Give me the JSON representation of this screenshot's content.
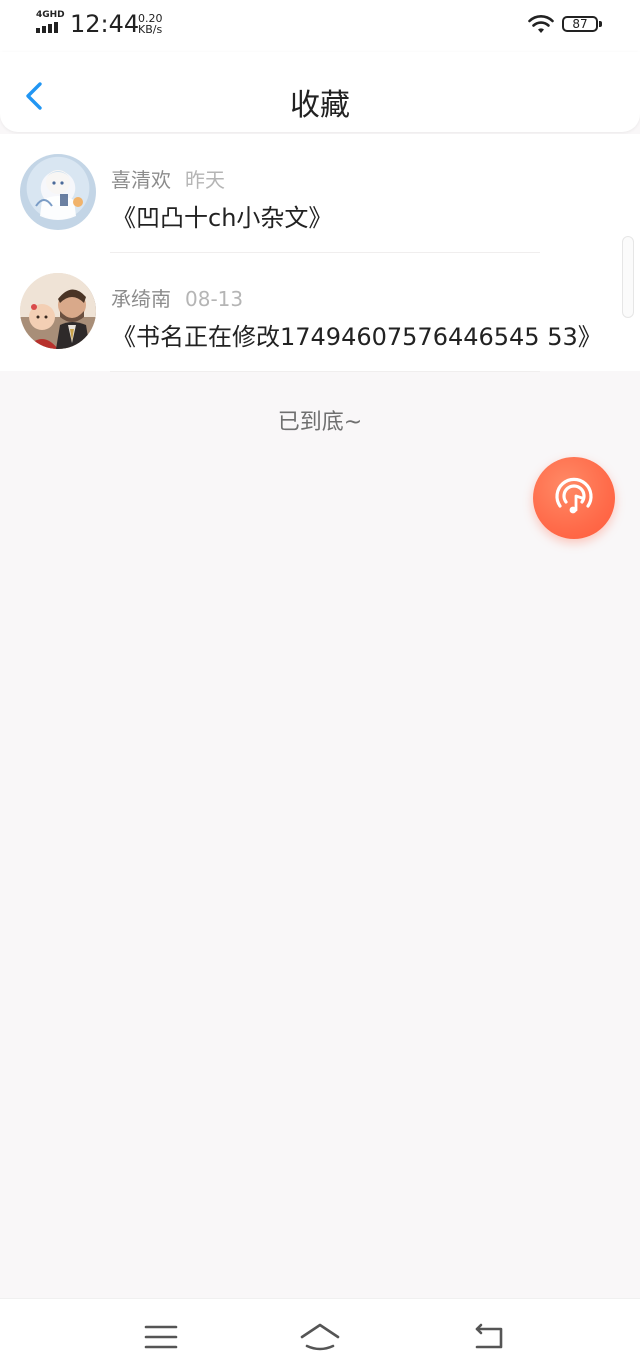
{
  "status_bar": {
    "network": "4GHD",
    "time": "12:44",
    "speed_value": "0.20",
    "speed_unit": "KB/s",
    "battery": "87"
  },
  "header": {
    "title": "收藏",
    "back_icon": "chevron-left-icon",
    "accent_color": "#2196f3"
  },
  "favorites": [
    {
      "author": "喜清欢",
      "time": "昨天",
      "title": "《凹凸十ch小杂文》"
    },
    {
      "author": "承绮南",
      "time": "08-13",
      "title": "《书名正在修改17494607576446545 53》"
    }
  ],
  "end_message": "已到底~",
  "fab": {
    "icon": "audio-podcast-icon",
    "color": "#ff6b4a"
  },
  "bottom_nav": {
    "icons": [
      "menu-icon",
      "home-icon",
      "back-icon"
    ]
  }
}
